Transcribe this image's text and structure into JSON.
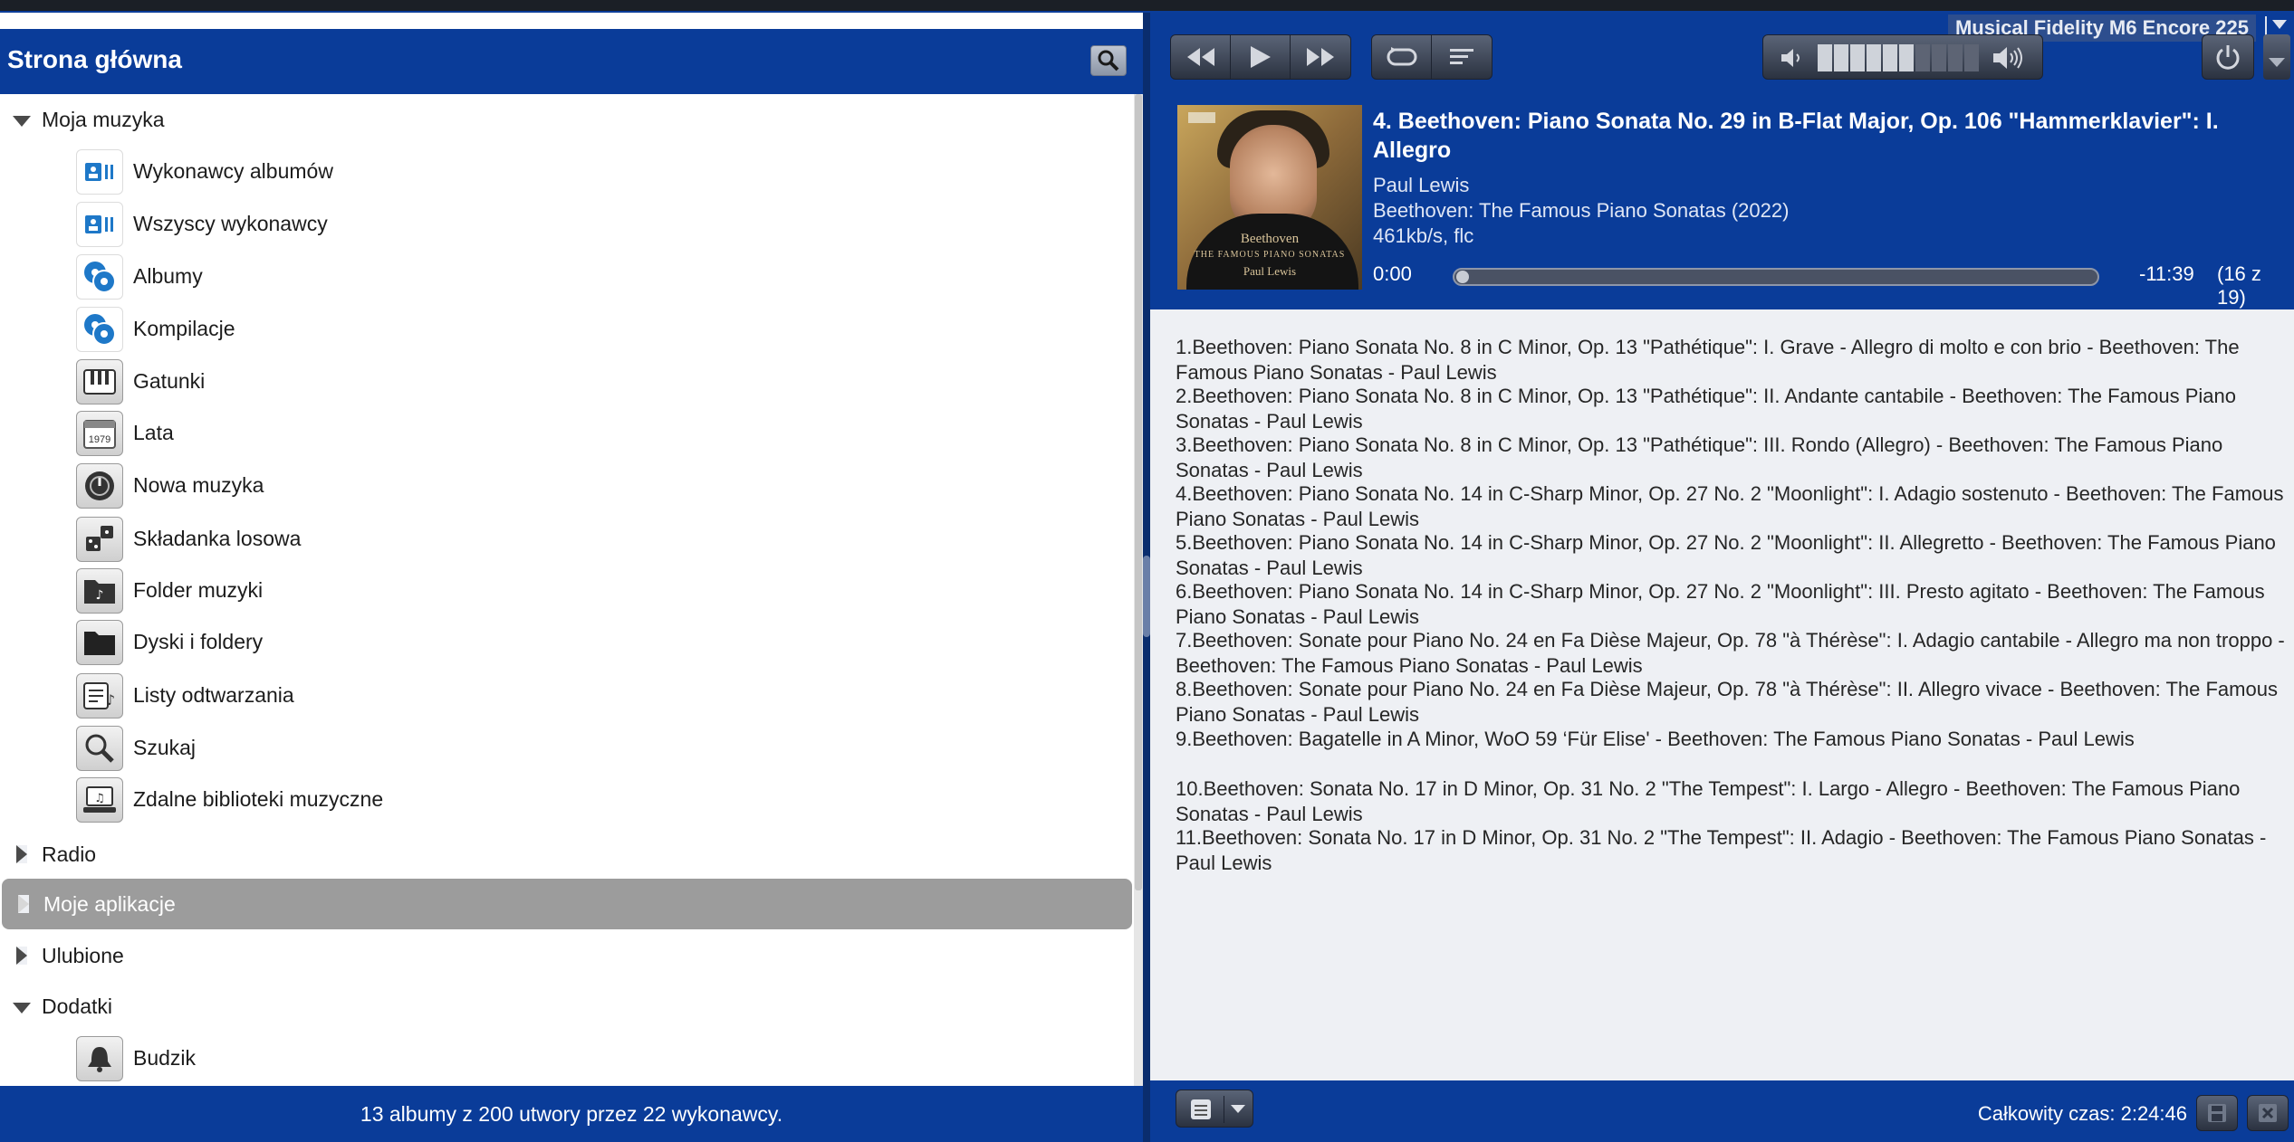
{
  "left": {
    "title": "Strona główna",
    "tree": [
      {
        "label": "Moja muzyka",
        "type": "expanded",
        "top": 0
      },
      {
        "label": "Wykonawcy albumów",
        "type": "child",
        "icon": "album-artists-icon"
      },
      {
        "label": "Wszyscy wykonawcy",
        "type": "child",
        "icon": "all-artists-icon"
      },
      {
        "label": "Albumy",
        "type": "child",
        "icon": "albums-icon"
      },
      {
        "label": "Kompilacje",
        "type": "child",
        "icon": "compilations-icon"
      },
      {
        "label": "Gatunki",
        "type": "child",
        "icon": "genres-icon"
      },
      {
        "label": "Lata",
        "type": "child",
        "icon": "years-icon"
      },
      {
        "label": "Nowa muzyka",
        "type": "child",
        "icon": "new-music-icon"
      },
      {
        "label": "Składanka losowa",
        "type": "child",
        "icon": "random-mix-icon"
      },
      {
        "label": "Folder muzyki",
        "type": "child",
        "icon": "music-folder-icon"
      },
      {
        "label": "Dyski i foldery",
        "type": "child",
        "icon": "disks-folders-icon"
      },
      {
        "label": "Listy odtwarzania",
        "type": "child",
        "icon": "playlists-icon"
      },
      {
        "label": "Szukaj",
        "type": "child",
        "icon": "search-icon"
      },
      {
        "label": "Zdalne biblioteki muzyczne",
        "type": "child",
        "icon": "remote-libraries-icon"
      },
      {
        "label": "Radio",
        "type": "collapsed"
      },
      {
        "label": "Moje aplikacje",
        "type": "collapsed",
        "selected": true
      },
      {
        "label": "Ulubione",
        "type": "collapsed"
      },
      {
        "label": "Dodatki",
        "type": "expanded"
      },
      {
        "label": "Budzik",
        "type": "child",
        "icon": "alarm-bell-icon"
      }
    ],
    "footer": "13 albumy z 200 utwory przez 22 wykonawcy."
  },
  "player": {
    "device": "Musical Fidelity M6 Encore 225",
    "track_title": "4. Beethoven: Piano Sonata No. 29 in B-Flat Major, Op. 106 \"Hammerklavier\": I. Allegro",
    "artist": "Paul Lewis",
    "album": "Beethoven: The Famous Piano Sonatas (2022)",
    "bitrate": "461kb/s, flc",
    "elapsed": "0:00",
    "remaining": "-11:39",
    "count": "(16 z 19)",
    "progress": 0.0,
    "volume_level": 0.6,
    "cover": {
      "line1": "Beethoven",
      "line2": "THE FAMOUS PIANO SONATAS",
      "line3": "Paul Lewis"
    }
  },
  "playlist": [
    "1.Beethoven: Piano Sonata No. 8 in C Minor, Op. 13 \"Pathétique\": I. Grave - Allegro di molto e con brio - Beethoven: The Famous Piano Sonatas - Paul Lewis",
    "2.Beethoven: Piano Sonata No. 8 in C Minor, Op. 13 \"Pathétique\": II. Andante cantabile - Beethoven: The Famous Piano Sonatas - Paul Lewis",
    "3.Beethoven: Piano Sonata No. 8 in C Minor, Op. 13 \"Pathétique\": III. Rondo (Allegro) - Beethoven: The Famous Piano Sonatas - Paul Lewis",
    "4.Beethoven: Piano Sonata No. 14 in C-Sharp Minor, Op. 27 No. 2 \"Moonlight\": I. Adagio sostenuto - Beethoven: The Famous Piano Sonatas - Paul Lewis",
    "5.Beethoven: Piano Sonata No. 14 in C-Sharp Minor, Op. 27 No. 2 \"Moonlight\": II. Allegretto - Beethoven: The Famous Piano Sonatas - Paul Lewis",
    "6.Beethoven: Piano Sonata No. 14 in C-Sharp Minor, Op. 27 No. 2 \"Moonlight\": III. Presto agitato - Beethoven: The Famous Piano Sonatas - Paul Lewis",
    "7.Beethoven: Sonate pour Piano No. 24 en Fa Dièse Majeur, Op. 78 \"à Thérèse\": I. Adagio cantabile - Allegro ma non troppo - Beethoven: The Famous Piano Sonatas - Paul Lewis",
    "8.Beethoven: Sonate pour Piano No. 24 en Fa Dièse Majeur, Op. 78 \"à Thérèse\": II. Allegro vivace - Beethoven: The Famous Piano Sonatas - Paul Lewis",
    "9.Beethoven: Bagatelle in A Minor, WoO 59 ‘Für Elise' - Beethoven: The Famous Piano Sonatas - Paul Lewis",
    "10.Beethoven: Sonata No. 17 in D Minor, Op. 31 No. 2 \"The Tempest\": I. Largo - Allegro - Beethoven: The Famous Piano Sonatas - Paul Lewis",
    "11.Beethoven: Sonata No. 17 in D Minor, Op. 31 No. 2 \"The Tempest\": II. Adagio - Beethoven: The Famous Piano Sonatas - Paul Lewis"
  ],
  "footer": {
    "total_time": "Całkowity czas: 2:24:46"
  },
  "colors": {
    "header_blue": "#0a3c99",
    "selected_row": "#9c9c9c",
    "playlist_bg": "#eef0f4"
  }
}
